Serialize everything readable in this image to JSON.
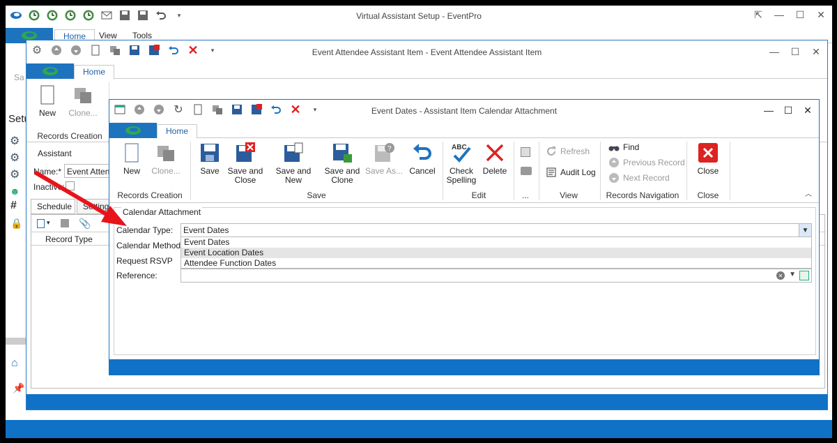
{
  "main_window": {
    "title": "Virtual Assistant Setup - EventPro",
    "tabs": [
      "Home",
      "View",
      "Tools"
    ],
    "left_cut": {
      "save_label": "Sa",
      "setup_label": "Setu"
    }
  },
  "middle_window": {
    "title": "Event Attendee Assistant Item - Event Attendee Assistant Item",
    "tab": "Home",
    "new_label": "New",
    "clone_label": "Clone...",
    "group_label": "Records Creation",
    "assistant_section": "Assistant",
    "name_label": "Name:*",
    "name_value": "Event Attend",
    "inactive_label": "Inactive:",
    "subtabs": [
      "Schedule",
      "Settings"
    ],
    "column_header": "Record Type"
  },
  "front_window": {
    "title": "Event Dates - Assistant Item Calendar Attachment",
    "tab": "Home",
    "ribbon": {
      "new": "New",
      "clone": "Clone...",
      "save": "Save",
      "save_and_close_1": "Save and",
      "save_and_close_2": "Close",
      "save_and_new": "Save and New",
      "save_and_clone_1": "Save and",
      "save_and_clone_2": "Clone",
      "save_as": "Save As...",
      "cancel": "Cancel",
      "check_spelling_1": "Check",
      "check_spelling_2": "Spelling",
      "delete": "Delete",
      "refresh": "Refresh",
      "audit_log": "Audit Log",
      "find": "Find",
      "previous_record": "Previous Record",
      "next_record": "Next Record",
      "close": "Close"
    },
    "groups": {
      "records_creation": "Records Creation",
      "save": "Save",
      "edit": "Edit",
      "more": "...",
      "view": "View",
      "records_navigation": "Records Navigation",
      "close": "Close"
    },
    "section_title": "Calendar Attachment",
    "form": {
      "calendar_type_label": "Calendar Type:",
      "calendar_type_value": "Event Dates",
      "calendar_method_label": "Calendar Method:",
      "request_rsvp_label": "Request RSVP",
      "reference_label": "Reference:"
    },
    "dropdown_options": [
      "Event Dates",
      "Event Location Dates",
      "Attendee Function Dates"
    ],
    "highlighted_option": "Event Location Dates"
  },
  "colors": {
    "accent": "#0f72c6",
    "arrow": "#e8141b",
    "window_border": "#2b79c5"
  }
}
